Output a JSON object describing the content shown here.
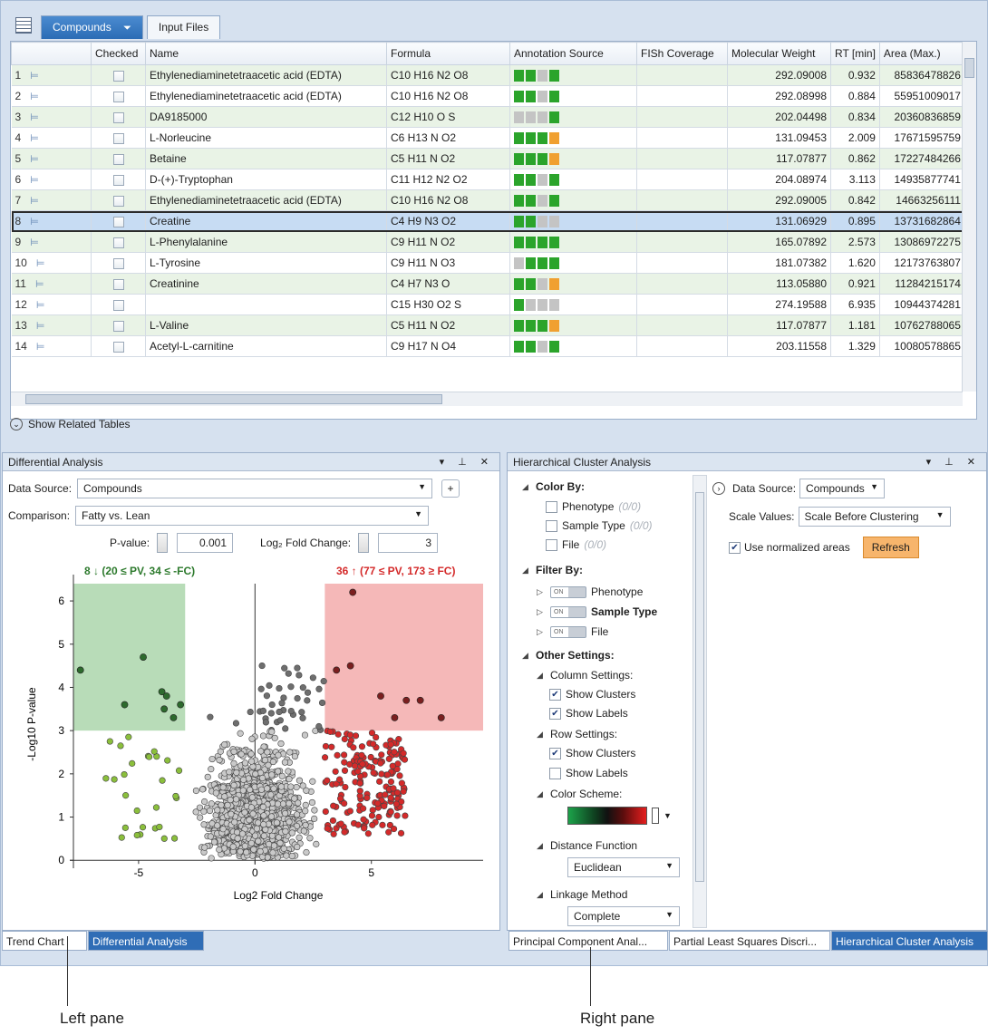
{
  "tabs": {
    "compounds": "Compounds",
    "input_files": "Input Files"
  },
  "table": {
    "columns": [
      "",
      "Checked",
      "Name",
      "Formula",
      "Annotation Source",
      "FISh Coverage",
      "Molecular Weight",
      "RT [min]",
      "Area (Max.)"
    ],
    "rows": [
      {
        "n": "1",
        "name": "Ethylenediaminetetraacetic acid (EDTA)",
        "formula": "C10 H16 N2 O8",
        "ann": [
          "green",
          "green",
          "gray",
          "green"
        ],
        "mw": "292.09008",
        "rt": "0.932",
        "area": "85836478826"
      },
      {
        "n": "2",
        "name": "Ethylenediaminetetraacetic acid (EDTA)",
        "formula": "C10 H16 N2 O8",
        "ann": [
          "green",
          "green",
          "gray",
          "green"
        ],
        "mw": "292.08998",
        "rt": "0.884",
        "area": "55951009017"
      },
      {
        "n": "3",
        "name": "DA9185000",
        "formula": "C12 H10 O S",
        "ann": [
          "gray",
          "gray",
          "gray",
          "green"
        ],
        "mw": "202.04498",
        "rt": "0.834",
        "area": "20360836859"
      },
      {
        "n": "4",
        "name": "L-Norleucine",
        "formula": "C6 H13 N O2",
        "ann": [
          "green",
          "green",
          "green",
          "orange"
        ],
        "mw": "131.09453",
        "rt": "2.009",
        "area": "17671595759"
      },
      {
        "n": "5",
        "name": "Betaine",
        "formula": "C5 H11 N O2",
        "ann": [
          "green",
          "green",
          "green",
          "orange"
        ],
        "mw": "117.07877",
        "rt": "0.862",
        "area": "17227484266"
      },
      {
        "n": "6",
        "name": "D-(+)-Tryptophan",
        "formula": "C11 H12 N2 O2",
        "ann": [
          "green",
          "green",
          "gray",
          "green"
        ],
        "mw": "204.08974",
        "rt": "3.113",
        "area": "14935877741"
      },
      {
        "n": "7",
        "name": "Ethylenediaminetetraacetic acid (EDTA)",
        "formula": "C10 H16 N2 O8",
        "ann": [
          "green",
          "green",
          "gray",
          "green"
        ],
        "mw": "292.09005",
        "rt": "0.842",
        "area": "14663256111"
      },
      {
        "n": "8",
        "name": "Creatine",
        "formula": "C4 H9 N3 O2",
        "ann": [
          "green",
          "green",
          "gray",
          "gray"
        ],
        "mw": "131.06929",
        "rt": "0.895",
        "area": "13731682864"
      },
      {
        "n": "9",
        "name": "L-Phenylalanine",
        "formula": "C9 H11 N O2",
        "ann": [
          "green",
          "green",
          "green",
          "green"
        ],
        "mw": "165.07892",
        "rt": "2.573",
        "area": "13086972275"
      },
      {
        "n": "10",
        "name": "L-Tyrosine",
        "formula": "C9 H11 N O3",
        "ann": [
          "gray",
          "green",
          "green",
          "green"
        ],
        "mw": "181.07382",
        "rt": "1.620",
        "area": "12173763807"
      },
      {
        "n": "11",
        "name": "Creatinine",
        "formula": "C4 H7 N3 O",
        "ann": [
          "green",
          "green",
          "gray",
          "orange"
        ],
        "mw": "113.05880",
        "rt": "0.921",
        "area": "11284215174"
      },
      {
        "n": "12",
        "name": "",
        "formula": "C15 H30 O2 S",
        "ann": [
          "green",
          "gray",
          "gray",
          "gray"
        ],
        "mw": "274.19588",
        "rt": "6.935",
        "area": "10944374281"
      },
      {
        "n": "13",
        "name": "L-Valine",
        "formula": "C5 H11 N O2",
        "ann": [
          "green",
          "green",
          "green",
          "orange"
        ],
        "mw": "117.07877",
        "rt": "1.181",
        "area": "10762788065"
      },
      {
        "n": "14",
        "name": "Acetyl-L-carnitine",
        "formula": "C9 H17 N O4",
        "ann": [
          "green",
          "green",
          "gray",
          "green"
        ],
        "mw": "203.11558",
        "rt": "1.329",
        "area": "10080578865"
      }
    ],
    "selected_row": 8
  },
  "show_related": "Show Related Tables",
  "left_pane": {
    "title": "Differential Analysis",
    "data_source_label": "Data Source:",
    "data_source_value": "Compounds",
    "comparison_label": "Comparison:",
    "comparison_value": "Fatty vs. Lean",
    "pvalue_label": "P-value:",
    "pvalue_value": "0.001",
    "fc_label": "Log₂ Fold Change:",
    "fc_value": "3",
    "down_summary": "8 ↓ (20 ≤ PV, 34 ≤ -FC)",
    "up_summary": "36 ↑ (77 ≤ PV, 173 ≥ FC)"
  },
  "chart_data": {
    "type": "scatter",
    "xlabel": "Log2 Fold Change",
    "ylabel": "-Log10 P-value",
    "xlim": [
      -7.8,
      9.8
    ],
    "ylim": [
      -0.1,
      6.4
    ],
    "x_ticks": [
      -5,
      0,
      5
    ],
    "y_ticks": [
      0,
      1,
      2,
      3,
      4,
      5,
      6
    ],
    "thresholds": {
      "fc": 3,
      "neg_log10_p": 3
    },
    "colors": {
      "down": "#8bbf3c",
      "down_sig": "#2d6a2d",
      "up": "#d42a2a",
      "up_sig": "#7a1f1f",
      "ns": "#c9c9c9",
      "ns_high": "#6e6e6e",
      "down_region": "#b8dcb8",
      "up_region": "#f5b8b8"
    },
    "significant_down": [
      [
        -7.5,
        4.4
      ],
      [
        -4.8,
        4.7
      ],
      [
        -5.6,
        3.6
      ],
      [
        -4.0,
        3.9
      ],
      [
        -3.8,
        3.8
      ],
      [
        -3.9,
        3.5
      ],
      [
        -3.5,
        3.3
      ],
      [
        -3.2,
        3.6
      ]
    ],
    "significant_up_examples": [
      [
        4.2,
        6.2
      ],
      [
        3.5,
        4.4
      ],
      [
        4.1,
        4.5
      ],
      [
        5.4,
        3.8
      ],
      [
        6.5,
        3.7
      ],
      [
        7.1,
        3.7
      ],
      [
        8.0,
        3.3
      ],
      [
        6.0,
        3.3
      ]
    ]
  },
  "right_pane": {
    "title": "Hierarchical Cluster Analysis",
    "color_by": "Color By:",
    "phenotype": "Phenotype",
    "sample_type": "Sample Type",
    "file": "File",
    "counts": "(0/0)",
    "filter_by": "Filter By:",
    "toggle_text": "ON",
    "other_settings": "Other Settings:",
    "column_settings": "Column Settings:",
    "show_clusters": "Show Clusters",
    "show_labels": "Show Labels",
    "row_settings": "Row Settings:",
    "color_scheme": "Color Scheme:",
    "distance_function": "Distance Function",
    "distance_value": "Euclidean",
    "linkage_method": "Linkage Method",
    "linkage_value": "Complete",
    "data_source_label": "Data Source:",
    "data_source_value": "Compounds",
    "scale_label": "Scale Values:",
    "scale_value": "Scale Before Clustering",
    "normalized": "Use normalized areas",
    "refresh": "Refresh"
  },
  "bottom_tabs": {
    "left": [
      "Trend Chart",
      "Differential Analysis"
    ],
    "right": [
      "Principal Component Anal...",
      "Partial Least Squares Discri...",
      "Hierarchical Cluster Analysis"
    ]
  },
  "callouts": {
    "left": "Left pane",
    "right": "Right pane"
  }
}
